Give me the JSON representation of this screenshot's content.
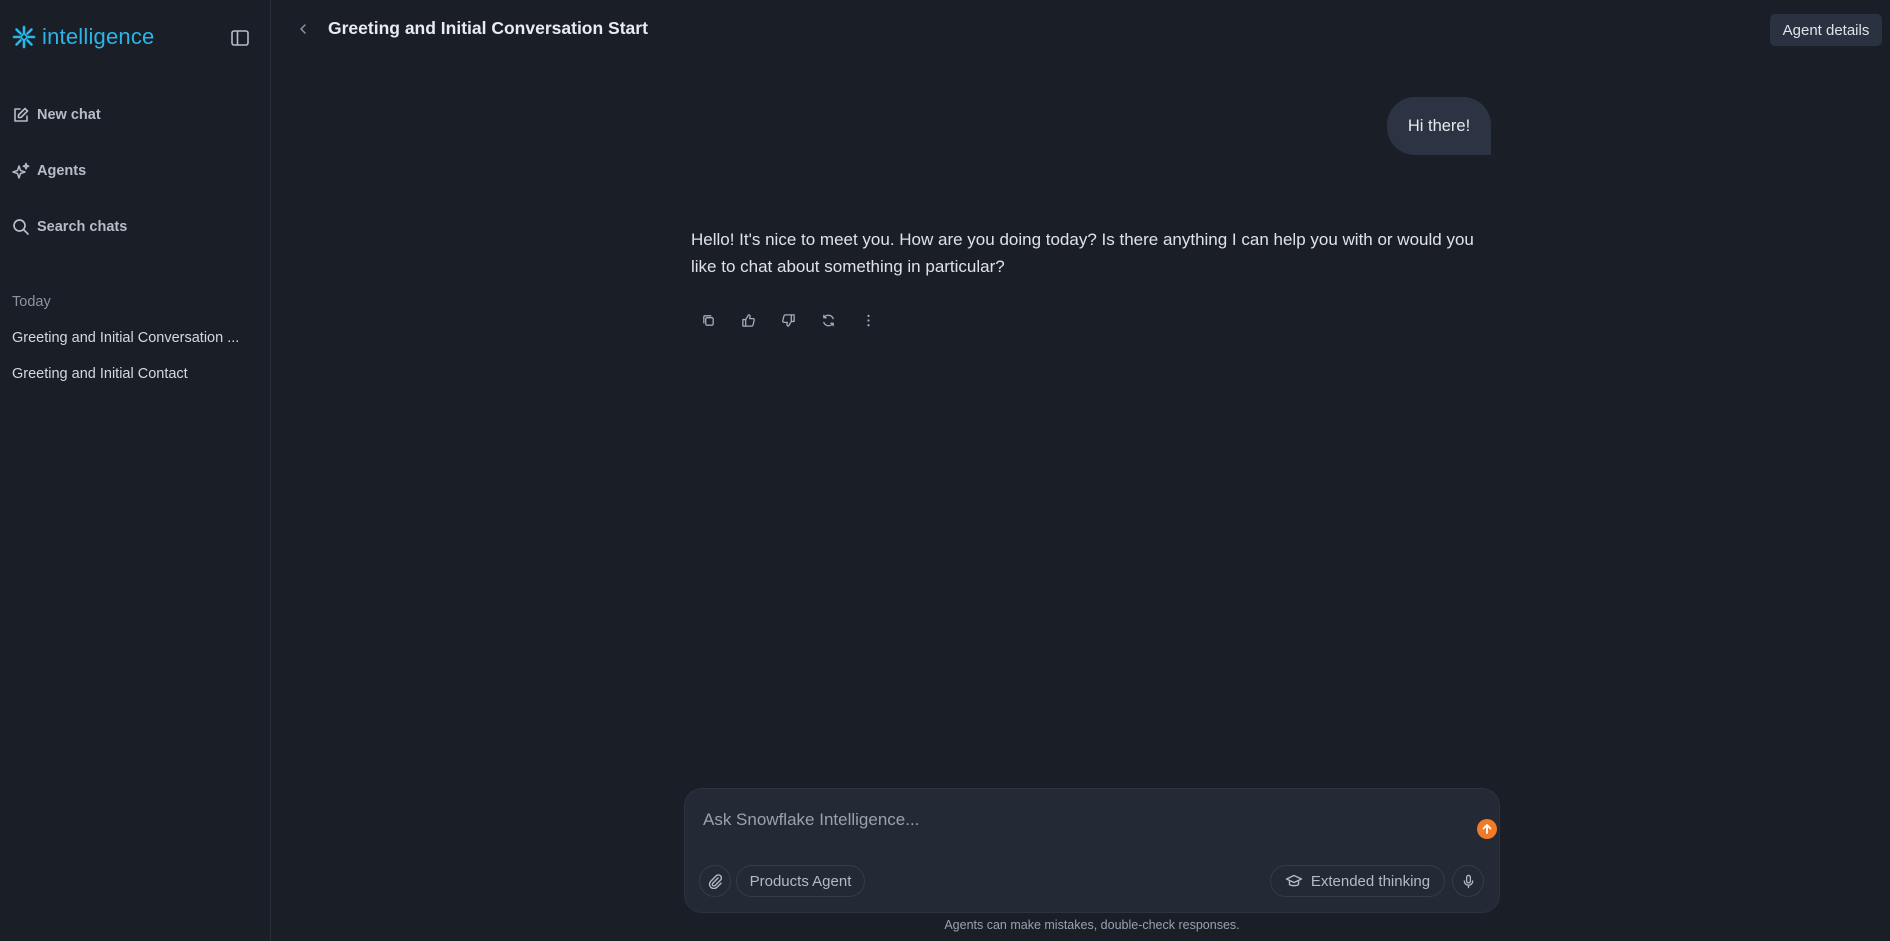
{
  "sidebar": {
    "brand": "intelligence",
    "nav": [
      {
        "label": "New chat",
        "icon": "edit-icon"
      },
      {
        "label": "Agents",
        "icon": "sparkle-icon"
      },
      {
        "label": "Search chats",
        "icon": "search-icon"
      }
    ],
    "section_label": "Today",
    "history": [
      {
        "title": "Greeting and Initial Conversation ..."
      },
      {
        "title": "Greeting and Initial Contact"
      }
    ]
  },
  "header": {
    "title": "Greeting and Initial Conversation Start",
    "agent_details_label": "Agent details"
  },
  "chat": {
    "user_message": "Hi there!",
    "assistant_message": "Hello! It's nice to meet you. How are you doing today? Is there anything I can help you with or would you like to chat about something in particular?",
    "actions": [
      "copy-icon",
      "thumbs-up-icon",
      "thumbs-down-icon",
      "refresh-icon",
      "more-vertical-icon"
    ]
  },
  "composer": {
    "placeholder": "Ask Snowflake Intelligence...",
    "agent_chip": "Products Agent",
    "extended_thinking": "Extended thinking",
    "disclaimer": "Agents can make mistakes, double-check responses."
  },
  "colors": {
    "background": "#1a1e26",
    "brand": "#29b5e8",
    "send": "#f07a27",
    "user_bubble": "#2c3444"
  }
}
